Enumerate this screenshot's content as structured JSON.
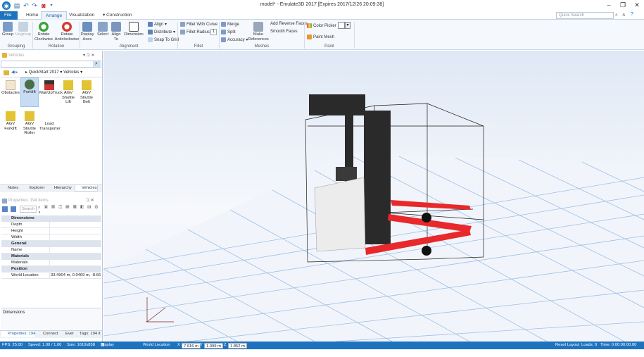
{
  "window": {
    "title": "model* - Emulate3D 2017 [Expires 2017/12/26 20:09:38]",
    "minimize": "–",
    "maximize": "❐",
    "close": "✕"
  },
  "menu": {
    "file": "File",
    "home": "Home",
    "arrange": "Arrange",
    "visualization": "Visualization",
    "construction": "Construction",
    "search_placeholder": "Quick Search"
  },
  "ribbon": {
    "group": "Group",
    "ungroup": "Ungroup",
    "grouping": "Grouping",
    "rotate_cw": "Rotate Clockwise",
    "rotate_acw": "Rotate Anticlockwise",
    "rotation": "Rotation",
    "display_axes": "Display Axes",
    "select": "Select",
    "align_to": "Align To",
    "dimension": "Dimension",
    "align": "Align",
    "distribute": "Distribute",
    "snap_to_grid": "Snap To Grid",
    "alignment": "Alignment",
    "fillet_with_curve": "Fillet With Curve",
    "fillet_radius": "Fillet Radius",
    "fillet_radius_value": "1",
    "fillet": "Fillet",
    "merge": "Merge",
    "split": "Split",
    "accuracy": "Accuracy",
    "make_references": "Make References",
    "add_reverse_faces": "Add Reverse Faces",
    "smooth_faces": "Smooth Faces",
    "meshes": "Meshes",
    "color_picker": "Color Picker",
    "paint_mesh": "Paint Mesh",
    "paint": "Paint"
  },
  "catalog": {
    "title": "Vehicles",
    "breadcrumb1": "QuickStart 2017",
    "breadcrumb2": "Vehicles",
    "items": [
      "Obstacles",
      "Forklift",
      "ManUpTruck",
      "AGV Shuttle Lift",
      "AGV Shuttle Belt",
      "AGV Forklift",
      "AGV Shuttle Roller",
      "Load Transporter"
    ],
    "tabs": [
      "Notes",
      "Explorer",
      "Hierarchy",
      "Vehicles"
    ]
  },
  "properties": {
    "title": "Properties: 194 items",
    "search_placeholder": "Search",
    "cat_dimensions": "Dimensions",
    "depth": "Depth",
    "height": "Height",
    "width": "Width",
    "cat_general": "General",
    "name": "Name",
    "cat_materials": "Materials",
    "materials": "Materials",
    "cat_position": "Position",
    "world_location": "World Location",
    "world_location_value": "33.4904 m, 0.0469 m, -8.66",
    "desc": "Dimensions",
    "tabs": [
      "Properties: 194",
      "Connect",
      "Ever",
      "Tags: 194 it"
    ]
  },
  "status": {
    "fps": "FPS: 25.00",
    "speed": "Speed: 1.00 / 1.00",
    "size": "Size: 1610x858",
    "display_settings": "Display Settings",
    "world_location": "World Location",
    "x_label": "X",
    "x": "7.616 m",
    "y_label": "Y",
    "y": "1.099 m",
    "z_label": "Z",
    "z": "1.852 m",
    "reset_layout": "Reset Layout",
    "loads": "Loads: 0",
    "time": "Time: 0:00:00:00.00"
  },
  "colors": {
    "accent": "#1e73be",
    "fork_red": "#e8282a",
    "mast_dark": "#2a2a2a"
  }
}
